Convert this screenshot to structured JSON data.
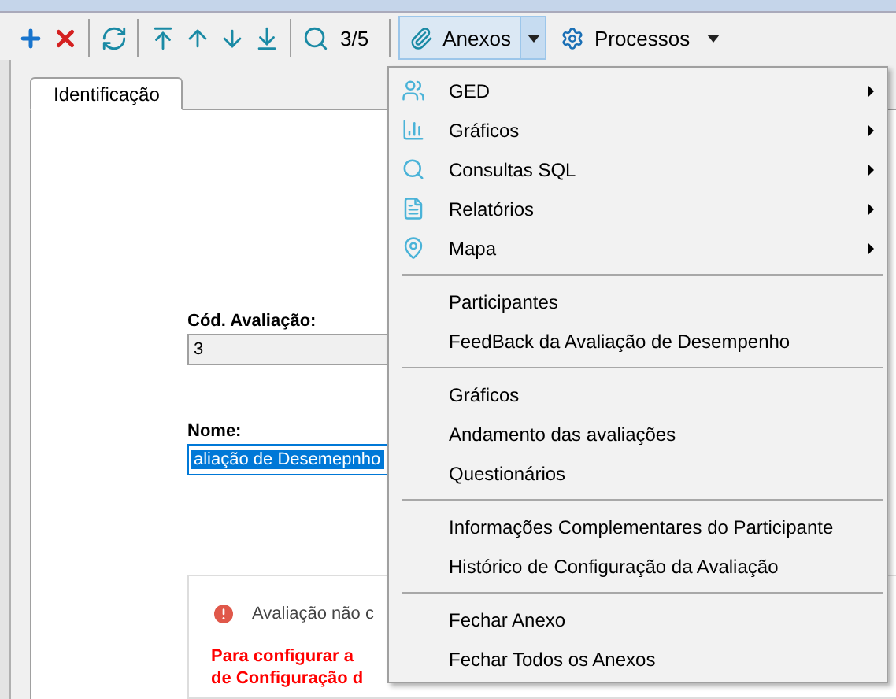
{
  "toolbar": {
    "buttons": [
      {
        "kind": "add"
      },
      {
        "kind": "delete"
      },
      {
        "kind": "separator"
      },
      {
        "kind": "refresh"
      },
      {
        "kind": "separator"
      },
      {
        "kind": "first"
      },
      {
        "kind": "previous"
      },
      {
        "kind": "next"
      },
      {
        "kind": "last"
      },
      {
        "kind": "separator"
      },
      {
        "kind": "search"
      }
    ],
    "record_counter": "3/5",
    "anexos": {
      "label": "Anexos",
      "expanded": true
    },
    "processos": {
      "label": "Processos",
      "expanded": false
    }
  },
  "tabs": [
    {
      "label": "Identificação",
      "selected": true
    }
  ],
  "form": {
    "fields": [
      {
        "label": "Cód. Avaliação:",
        "value": "3",
        "text_selected": false
      },
      {
        "label": "Nome:",
        "value": "aliação de Desemepnho",
        "text_selected": true
      }
    ],
    "message": {
      "text": "Avaliação não c",
      "warning_lines": [
        "Para configurar a",
        "de Configuração d"
      ]
    }
  },
  "menu": {
    "groups": [
      [
        {
          "label": "GED",
          "submenu": true
        },
        {
          "label": "Gráficos",
          "submenu": true
        },
        {
          "label": "Consultas SQL",
          "submenu": true
        },
        {
          "label": "Relatórios",
          "submenu": true
        },
        {
          "label": "Mapa",
          "submenu": true
        }
      ],
      [
        {
          "label": "Participantes",
          "submenu": false
        },
        {
          "label": "FeedBack da Avaliação de Desempenho",
          "submenu": false
        }
      ],
      [
        {
          "label": "Gráficos",
          "submenu": false
        },
        {
          "label": "Andamento das avaliações",
          "submenu": false
        },
        {
          "label": "Questionários",
          "submenu": false
        }
      ],
      [
        {
          "label": "Informações Complementares do Participante",
          "submenu": false
        },
        {
          "label": "Histórico de Configuração da Avaliação",
          "submenu": false
        }
      ],
      [
        {
          "label": "Fechar Anexo",
          "submenu": false
        },
        {
          "label": "Fechar Todos os Anexos",
          "submenu": false
        }
      ]
    ]
  }
}
